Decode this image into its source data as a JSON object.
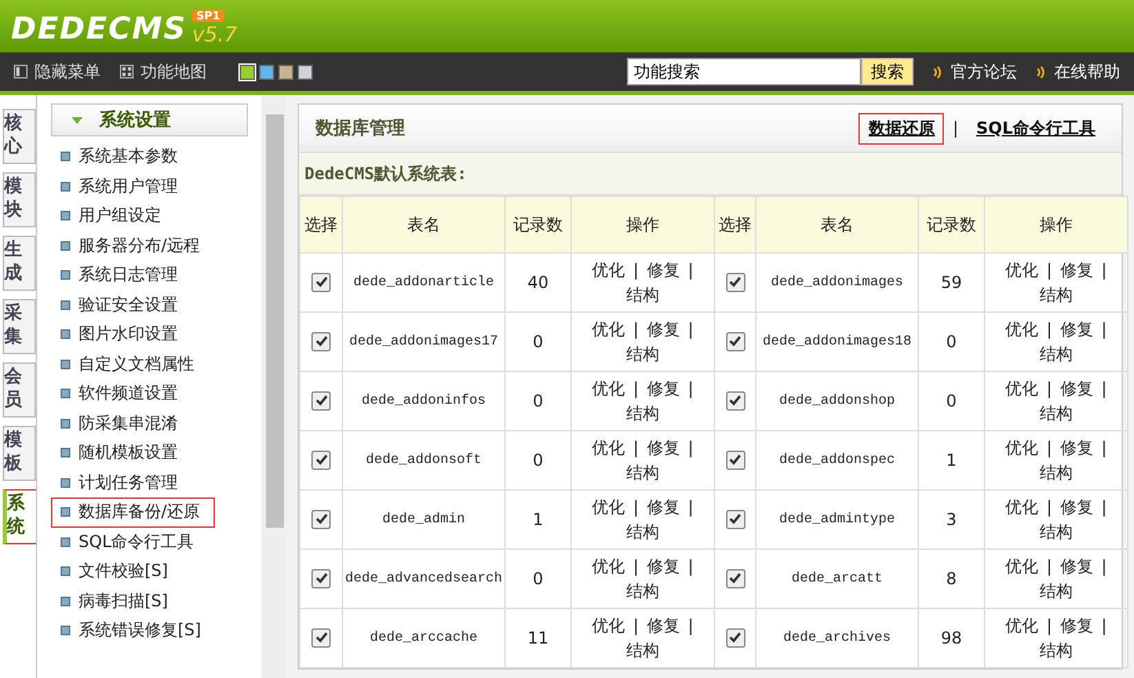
{
  "header": {
    "logo": "DEDECMS",
    "badge": "SP1",
    "version": "v5.7"
  },
  "toolbar": {
    "items": [
      {
        "label": "隐藏菜单"
      },
      {
        "label": "功能地图"
      }
    ],
    "swatches": [
      {
        "color": "#9acd32",
        "selected": true
      },
      {
        "color": "#5bb8e8",
        "selected": false
      },
      {
        "color": "#c8b48c",
        "selected": false
      },
      {
        "color": "#d0d4d8",
        "selected": false
      }
    ],
    "search": {
      "value": "功能搜索",
      "button": "搜索"
    },
    "links": [
      "官方论坛",
      "在线帮助"
    ]
  },
  "side_tabs": [
    {
      "label": "核心",
      "selected": false
    },
    {
      "label": "模块",
      "selected": false
    },
    {
      "label": "生成",
      "selected": false
    },
    {
      "label": "采集",
      "selected": false
    },
    {
      "label": "会员",
      "selected": false
    },
    {
      "label": "模板",
      "selected": false
    },
    {
      "label": "系统",
      "selected": true
    }
  ],
  "sidebar": {
    "title": "系统设置",
    "items": [
      {
        "label": "系统基本参数",
        "selected": false
      },
      {
        "label": "系统用户管理",
        "selected": false
      },
      {
        "label": "用户组设定",
        "selected": false
      },
      {
        "label": "服务器分布/远程",
        "selected": false
      },
      {
        "label": "系统日志管理",
        "selected": false
      },
      {
        "label": "验证安全设置",
        "selected": false
      },
      {
        "label": "图片水印设置",
        "selected": false
      },
      {
        "label": "自定义文档属性",
        "selected": false
      },
      {
        "label": "软件频道设置",
        "selected": false
      },
      {
        "label": "防采集串混淆",
        "selected": false
      },
      {
        "label": "随机模板设置",
        "selected": false
      },
      {
        "label": "计划任务管理",
        "selected": false
      },
      {
        "label": "数据库备份/还原",
        "selected": true
      },
      {
        "label": "SQL命令行工具",
        "selected": false
      },
      {
        "label": "文件校验[S]",
        "selected": false
      },
      {
        "label": "病毒扫描[S]",
        "selected": false
      },
      {
        "label": "系统错误修复[S]",
        "selected": false
      }
    ]
  },
  "panel": {
    "title": "数据库管理",
    "links": [
      {
        "label": "数据还原",
        "selected": true
      },
      {
        "label": "SQL命令行工具",
        "selected": false
      }
    ],
    "link_separator": "|",
    "subtitle": "DedeCMS默认系统表:",
    "columns": [
      "选择",
      "表名",
      "记录数",
      "操作",
      "选择",
      "表名",
      "记录数",
      "操作"
    ],
    "rows": [
      [
        {
          "checked": true
        },
        "dede_addonarticle",
        "40",
        "优化 | 修复 | 结构",
        {
          "checked": true
        },
        "dede_addonimages",
        "59",
        "优化 | 修复 | 结构"
      ],
      [
        {
          "checked": true
        },
        "dede_addonimages17",
        "0",
        "优化 | 修复 | 结构",
        {
          "checked": true
        },
        "dede_addonimages18",
        "0",
        "优化 | 修复 | 结构"
      ],
      [
        {
          "checked": true
        },
        "dede_addoninfos",
        "0",
        "优化 | 修复 | 结构",
        {
          "checked": true
        },
        "dede_addonshop",
        "0",
        "优化 | 修复 | 结构"
      ],
      [
        {
          "checked": true
        },
        "dede_addonsoft",
        "0",
        "优化 | 修复 | 结构",
        {
          "checked": true
        },
        "dede_addonspec",
        "1",
        "优化 | 修复 | 结构"
      ],
      [
        {
          "checked": true
        },
        "dede_admin",
        "1",
        "优化 | 修复 | 结构",
        {
          "checked": true
        },
        "dede_admintype",
        "3",
        "优化 | 修复 | 结构"
      ],
      [
        {
          "checked": true
        },
        "dede_advancedsearch",
        "0",
        "优化 | 修复 | 结构",
        {
          "checked": true
        },
        "dede_arcatt",
        "8",
        "优化 | 修复 | 结构"
      ],
      [
        {
          "checked": true
        },
        "dede_arccache",
        "11",
        "优化 | 修复 | 结构",
        {
          "checked": true
        },
        "dede_archives",
        "98",
        "优化 | 修复 | 结构"
      ]
    ]
  }
}
